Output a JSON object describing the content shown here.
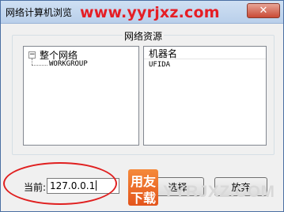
{
  "window": {
    "title": "网络计算机浏览",
    "close_glyph": "✕"
  },
  "watermark": {
    "url": "www.yyrjxz.com",
    "logo_line1": "用友",
    "logo_line2": "下载",
    "domain": "YYRJXZ.COM"
  },
  "resources": {
    "group_label": "网络资源",
    "tree": {
      "root_label": "整个网络",
      "root_expander": "−",
      "child_label": "WORKGROUP"
    },
    "list": {
      "column_header": "机器名",
      "rows": [
        "UFIDA"
      ]
    }
  },
  "current": {
    "label": "当前:",
    "value": "127.0.0.1"
  },
  "buttons": {
    "select_label": "选择",
    "giveup_label": "放弃"
  },
  "colors": {
    "watermark_red": "#e51e25",
    "annotation_red": "#e02020",
    "logo_orange": "#f58a3a"
  }
}
